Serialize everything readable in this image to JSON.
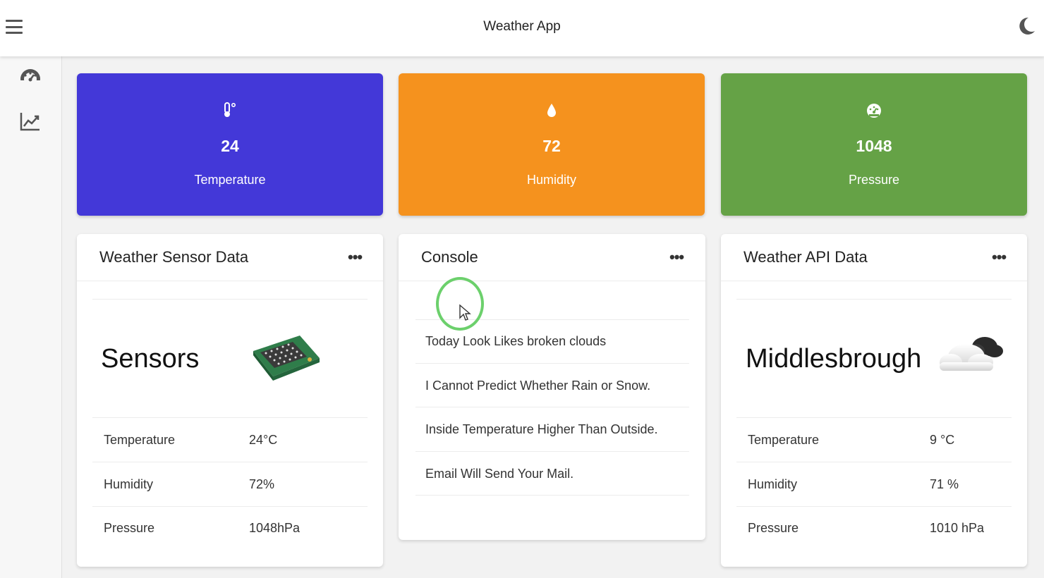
{
  "header": {
    "title": "Weather App"
  },
  "stats": [
    {
      "value": "24",
      "label": "Temperature",
      "color": "#4338d8",
      "icon": "thermometer-icon"
    },
    {
      "value": "72",
      "label": "Humidity",
      "color": "#f5921e",
      "icon": "water-drop-icon"
    },
    {
      "value": "1048",
      "label": "Pressure",
      "color": "#65a246",
      "icon": "gauge-icon"
    }
  ],
  "sensor_panel": {
    "title": "Weather Sensor Data",
    "name": "Sensors",
    "rows": [
      {
        "label": "Temperature",
        "value": "24°C"
      },
      {
        "label": "Humidity",
        "value": "72%"
      },
      {
        "label": "Pressure",
        "value": "1048hPa"
      }
    ]
  },
  "console_panel": {
    "title": "Console",
    "lines": [
      "Today Look Likes broken clouds",
      "I Cannot Predict Whether Rain or Snow.",
      "Inside Temperature Higher Than Outside.",
      "Email Will Send Your Mail."
    ]
  },
  "api_panel": {
    "title": "Weather API Data",
    "name": "Middlesbrough",
    "rows": [
      {
        "label": "Temperature",
        "value": "9 °C"
      },
      {
        "label": "Humidity",
        "value": "71 %"
      },
      {
        "label": "Pressure",
        "value": "1010 hPa"
      }
    ]
  },
  "more_label": "•••"
}
